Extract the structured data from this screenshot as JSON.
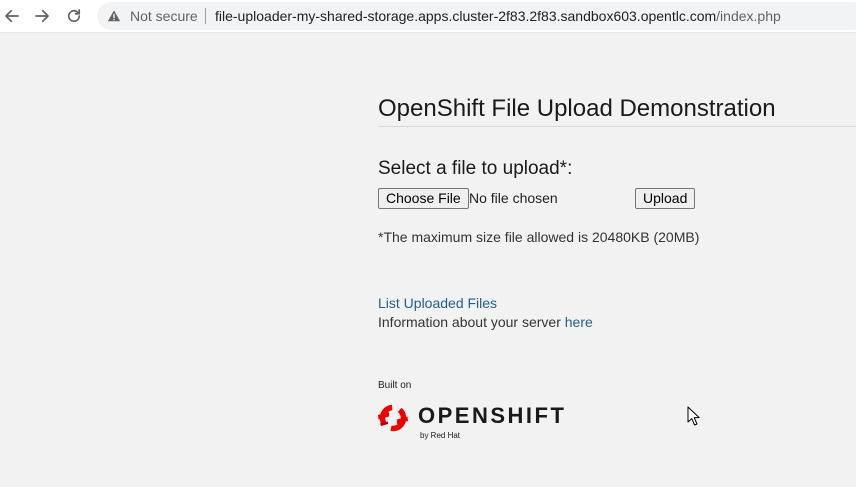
{
  "browser": {
    "security_label": "Not secure",
    "url_host": "file-uploader-my-shared-storage.apps.cluster-2f83.2f83.sandbox603.opentlc.com",
    "url_path": "/index.php"
  },
  "page": {
    "title": "OpenShift File Upload Demonstration",
    "upload_label": "Select a file to upload*:",
    "choose_file_label": "Choose File",
    "no_file_text": "No file chosen",
    "upload_button_label": "Upload",
    "max_size_note": "*The maximum size file allowed is 20480KB (20MB)",
    "list_files_link": "List Uploaded Files",
    "server_info_text": "Information about your server ",
    "server_info_link": "here",
    "built_on": "Built on"
  },
  "logo": {
    "wordmark": "OPENSHIFT",
    "byline": "by Red Hat",
    "brand_color": "#ee0000"
  },
  "icons": [
    "back-arrow-icon",
    "forward-arrow-icon",
    "reload-icon",
    "warning-icon",
    "openshift-logo-icon",
    "mouse-cursor-icon"
  ]
}
